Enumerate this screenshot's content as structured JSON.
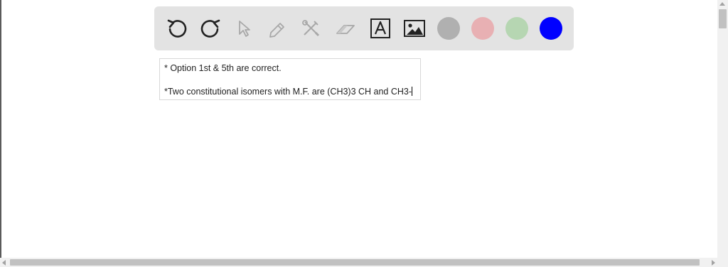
{
  "toolbar": {
    "tools": [
      {
        "name": "undo-icon",
        "state": "enabled"
      },
      {
        "name": "redo-icon",
        "state": "enabled"
      },
      {
        "name": "select-pointer-icon",
        "state": "disabled"
      },
      {
        "name": "pencil-icon",
        "state": "disabled"
      },
      {
        "name": "tools-icon",
        "state": "disabled"
      },
      {
        "name": "eraser-icon",
        "state": "disabled"
      },
      {
        "name": "text-tool-icon",
        "state": "enabled"
      },
      {
        "name": "image-tool-icon",
        "state": "enabled"
      }
    ],
    "colors": [
      "#b0b0b0",
      "#e8b0b3",
      "#b6d6b2",
      "#0000ff"
    ]
  },
  "textbox": {
    "line1": "* Option 1st & 5th are correct.",
    "line2": "*Two constitutional isomers with M.F. are (CH3)3 CH and CH3-"
  }
}
